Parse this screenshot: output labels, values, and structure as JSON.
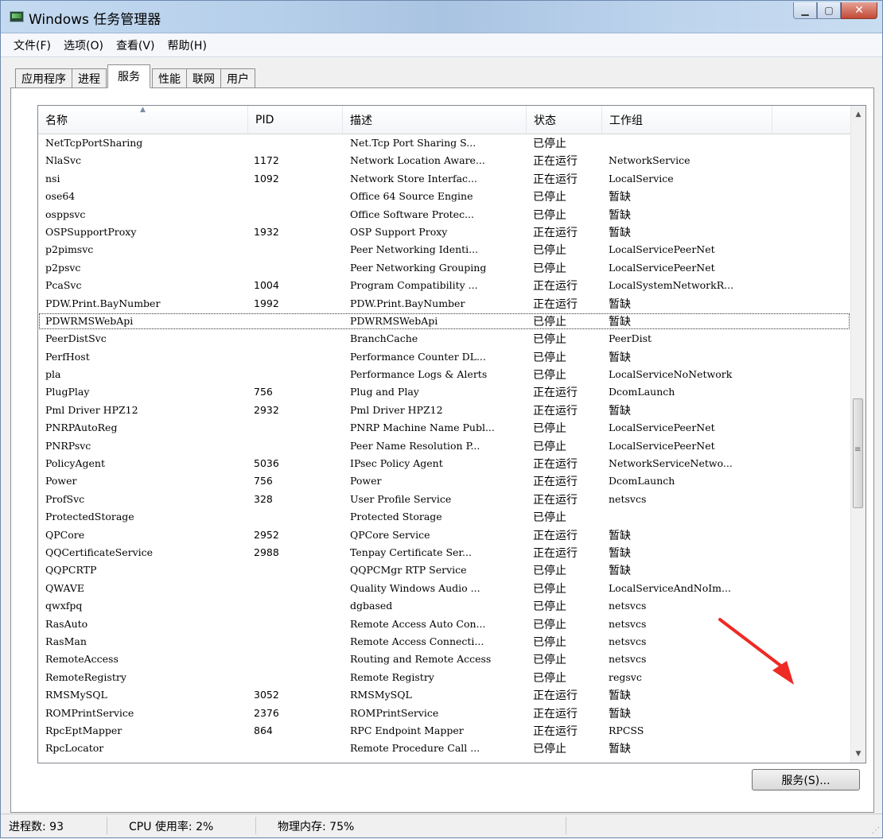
{
  "window": {
    "title": "Windows 任务管理器"
  },
  "menu": [
    "文件(F)",
    "选项(O)",
    "查看(V)",
    "帮助(H)"
  ],
  "tabs": [
    "应用程序",
    "进程",
    "服务",
    "性能",
    "联网",
    "用户"
  ],
  "active_tab": "服务",
  "columns": [
    "名称",
    "PID",
    "描述",
    "状态",
    "工作组"
  ],
  "services": [
    {
      "name": "NetTcpPortSharing",
      "pid": "",
      "desc": "Net.Tcp Port Sharing S...",
      "status": "已停止",
      "group": ""
    },
    {
      "name": "NlaSvc",
      "pid": "1172",
      "desc": "Network Location Aware...",
      "status": "正在运行",
      "group": "NetworkService"
    },
    {
      "name": "nsi",
      "pid": "1092",
      "desc": "Network Store Interfac...",
      "status": "正在运行",
      "group": "LocalService"
    },
    {
      "name": "ose64",
      "pid": "",
      "desc": "Office 64 Source Engine",
      "status": "已停止",
      "group": "暂缺"
    },
    {
      "name": "osppsvc",
      "pid": "",
      "desc": "Office Software Protec...",
      "status": "已停止",
      "group": "暂缺"
    },
    {
      "name": "OSPSupportProxy",
      "pid": "1932",
      "desc": "OSP Support Proxy",
      "status": "正在运行",
      "group": "暂缺"
    },
    {
      "name": "p2pimsvc",
      "pid": "",
      "desc": "Peer Networking Identi...",
      "status": "已停止",
      "group": "LocalServicePeerNet"
    },
    {
      "name": "p2psvc",
      "pid": "",
      "desc": "Peer Networking Grouping",
      "status": "已停止",
      "group": "LocalServicePeerNet"
    },
    {
      "name": "PcaSvc",
      "pid": "1004",
      "desc": "Program Compatibility ...",
      "status": "正在运行",
      "group": "LocalSystemNetworkR..."
    },
    {
      "name": "PDW.Print.BayNumber",
      "pid": "1992",
      "desc": "PDW.Print.BayNumber",
      "status": "正在运行",
      "group": "暂缺"
    },
    {
      "name": "PDWRMSWebApi",
      "pid": "",
      "desc": "PDWRMSWebApi",
      "status": "已停止",
      "group": "暂缺"
    },
    {
      "name": "PeerDistSvc",
      "pid": "",
      "desc": "BranchCache",
      "status": "已停止",
      "group": "PeerDist"
    },
    {
      "name": "PerfHost",
      "pid": "",
      "desc": "Performance Counter DL...",
      "status": "已停止",
      "group": "暂缺"
    },
    {
      "name": "pla",
      "pid": "",
      "desc": "Performance Logs & Alerts",
      "status": "已停止",
      "group": "LocalServiceNoNetwork"
    },
    {
      "name": "PlugPlay",
      "pid": "756",
      "desc": "Plug and Play",
      "status": "正在运行",
      "group": "DcomLaunch"
    },
    {
      "name": "Pml Driver HPZ12",
      "pid": "2932",
      "desc": "Pml Driver HPZ12",
      "status": "正在运行",
      "group": "暂缺"
    },
    {
      "name": "PNRPAutoReg",
      "pid": "",
      "desc": "PNRP Machine Name Publ...",
      "status": "已停止",
      "group": "LocalServicePeerNet"
    },
    {
      "name": "PNRPsvc",
      "pid": "",
      "desc": "Peer Name Resolution P...",
      "status": "已停止",
      "group": "LocalServicePeerNet"
    },
    {
      "name": "PolicyAgent",
      "pid": "5036",
      "desc": "IPsec Policy Agent",
      "status": "正在运行",
      "group": "NetworkServiceNetwo..."
    },
    {
      "name": "Power",
      "pid": "756",
      "desc": "Power",
      "status": "正在运行",
      "group": "DcomLaunch"
    },
    {
      "name": "ProfSvc",
      "pid": "328",
      "desc": "User Profile Service",
      "status": "正在运行",
      "group": "netsvcs"
    },
    {
      "name": "ProtectedStorage",
      "pid": "",
      "desc": "Protected Storage",
      "status": "已停止",
      "group": ""
    },
    {
      "name": "QPCore",
      "pid": "2952",
      "desc": "QPCore Service",
      "status": "正在运行",
      "group": "暂缺"
    },
    {
      "name": "QQCertificateService",
      "pid": "2988",
      "desc": "Tenpay Certificate Ser...",
      "status": "正在运行",
      "group": "暂缺"
    },
    {
      "name": "QQPCRTP",
      "pid": "",
      "desc": "QQPCMgr RTP Service",
      "status": "已停止",
      "group": "暂缺"
    },
    {
      "name": "QWAVE",
      "pid": "",
      "desc": "Quality Windows Audio ...",
      "status": "已停止",
      "group": "LocalServiceAndNoIm..."
    },
    {
      "name": "qwxfpq",
      "pid": "",
      "desc": "dgbased",
      "status": "已停止",
      "group": "netsvcs"
    },
    {
      "name": "RasAuto",
      "pid": "",
      "desc": "Remote Access Auto Con...",
      "status": "已停止",
      "group": "netsvcs"
    },
    {
      "name": "RasMan",
      "pid": "",
      "desc": "Remote Access Connecti...",
      "status": "已停止",
      "group": "netsvcs"
    },
    {
      "name": "RemoteAccess",
      "pid": "",
      "desc": "Routing and Remote Access",
      "status": "已停止",
      "group": "netsvcs"
    },
    {
      "name": "RemoteRegistry",
      "pid": "",
      "desc": "Remote Registry",
      "status": "已停止",
      "group": "regsvc"
    },
    {
      "name": "RMSMySQL",
      "pid": "3052",
      "desc": "RMSMySQL",
      "status": "正在运行",
      "group": "暂缺"
    },
    {
      "name": "ROMPrintService",
      "pid": "2376",
      "desc": "ROMPrintService",
      "status": "正在运行",
      "group": "暂缺"
    },
    {
      "name": "RpcEptMapper",
      "pid": "864",
      "desc": "RPC Endpoint Mapper",
      "status": "正在运行",
      "group": "RPCSS"
    },
    {
      "name": "RpcLocator",
      "pid": "",
      "desc": "Remote Procedure Call ...",
      "status": "已停止",
      "group": "暂缺"
    }
  ],
  "focused_row": "PDWRMSWebApi",
  "services_button": "服务(S)...",
  "statusbar": {
    "processes": "进程数: 93",
    "cpu": "CPU 使用率: 2%",
    "memory": "物理内存: 75%"
  },
  "colors": {
    "annotation_arrow": "#ee2a24"
  }
}
